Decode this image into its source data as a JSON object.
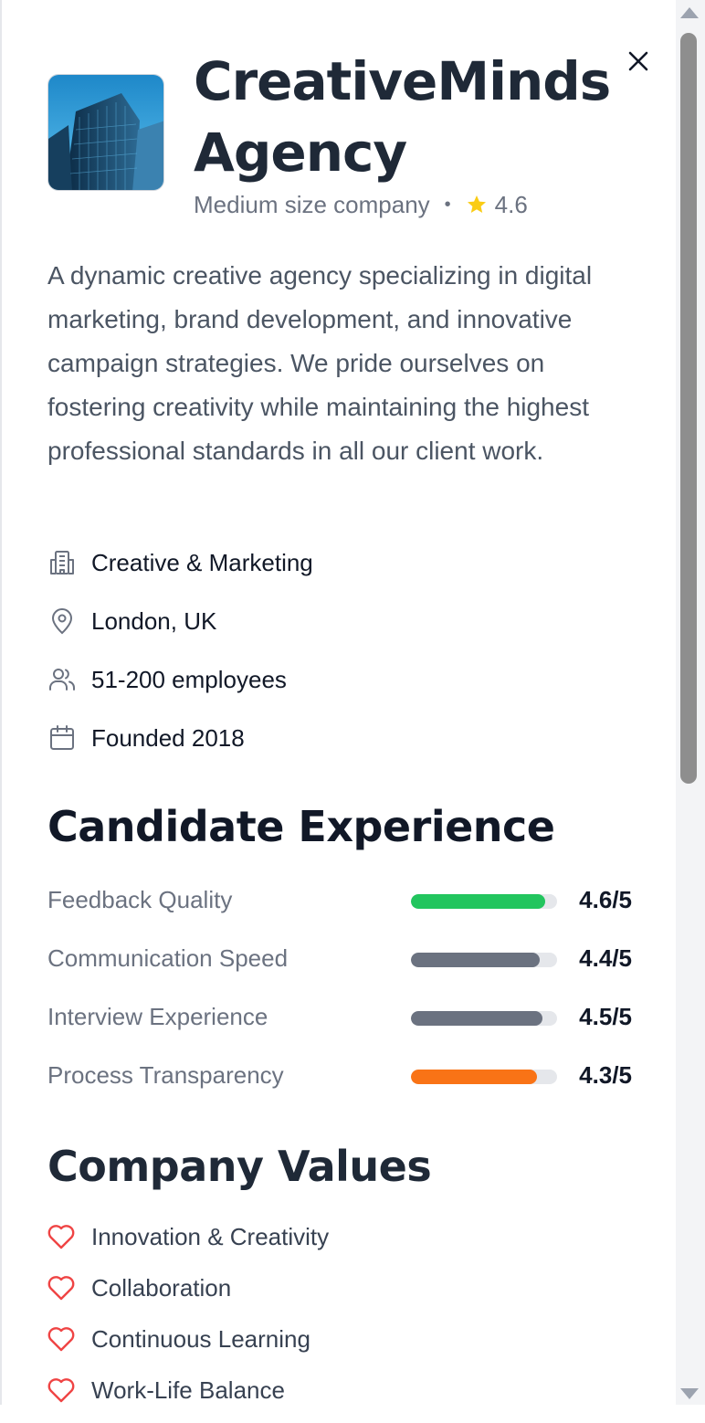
{
  "company": {
    "name": "CreativeMinds Agency",
    "size": "Medium size company",
    "separator": "•",
    "rating": "4.6",
    "description": "A dynamic creative agency specializing in digital marketing, brand development, and innovative campaign strategies. We pride ourselves on fostering creativity while maintaining the highest professional standards in all our client work."
  },
  "details": [
    {
      "icon": "building-icon",
      "text": "Creative & Marketing"
    },
    {
      "icon": "map-pin-icon",
      "text": "London, UK"
    },
    {
      "icon": "users-icon",
      "text": "51-200 employees"
    },
    {
      "icon": "calendar-icon",
      "text": "Founded 2018"
    }
  ],
  "candidate_experience": {
    "heading": "Candidate Experience",
    "items": [
      {
        "label": "Feedback Quality",
        "score": "4.6/5",
        "value": 4.6,
        "color": "#22c55e"
      },
      {
        "label": "Communication Speed",
        "score": "4.4/5",
        "value": 4.4,
        "color": "#6b7280"
      },
      {
        "label": "Interview Experience",
        "score": "4.5/5",
        "value": 4.5,
        "color": "#6b7280"
      },
      {
        "label": "Process Transparency",
        "score": "4.3/5",
        "value": 4.3,
        "color": "#f97316"
      }
    ]
  },
  "company_values": {
    "heading": "Company Values",
    "items": [
      "Innovation & Creativity",
      "Collaboration",
      "Continuous Learning",
      "Work-Life Balance"
    ]
  },
  "colors": {
    "star": "#facc15",
    "heart": "#ef4444",
    "text_primary": "#111827",
    "text_muted": "#6b7280"
  }
}
